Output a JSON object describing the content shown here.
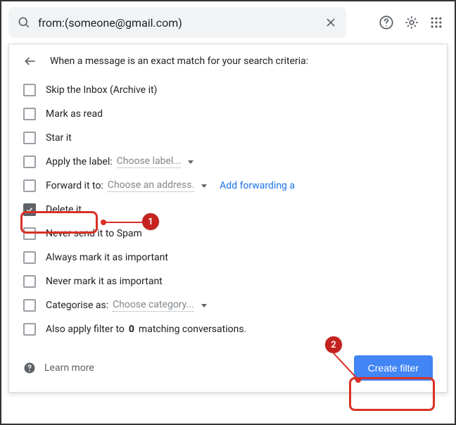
{
  "search": {
    "query": "from:(someone@gmail.com)"
  },
  "header": {
    "title": "When a message is an exact match for your search criteria:"
  },
  "options": [
    {
      "label": "Skip the Inbox (Archive it)",
      "checked": false
    },
    {
      "label": "Mark as read",
      "checked": false
    },
    {
      "label": "Star it",
      "checked": false
    },
    {
      "label": "Apply the label:",
      "checked": false,
      "dropdown": "Choose label..."
    },
    {
      "label": "Forward it to:",
      "checked": false,
      "dropdown": "Choose an address.",
      "link": "Add forwarding a"
    },
    {
      "label": "Delete it",
      "checked": true
    },
    {
      "label": "Never send it to Spam",
      "checked": false
    },
    {
      "label": "Always mark it as important",
      "checked": false
    },
    {
      "label": "Never mark it as important",
      "checked": false
    },
    {
      "label": "Categorise as:",
      "checked": false,
      "dropdown": "Choose category..."
    },
    {
      "label_pre": "Also apply filter to ",
      "bold": "0",
      "label_post": " matching conversations.",
      "checked": false
    }
  ],
  "footer": {
    "learn_more": "Learn more",
    "create": "Create filter"
  },
  "annotations": {
    "badge1": "1",
    "badge2": "2"
  }
}
